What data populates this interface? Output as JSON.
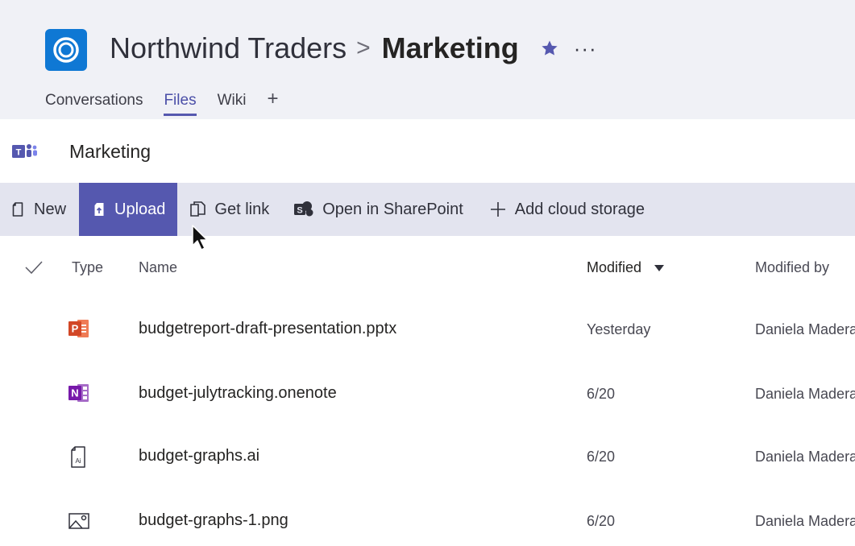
{
  "header": {
    "team_name": "Northwind Traders",
    "separator": ">",
    "channel_name": "Marketing",
    "more_label": "···",
    "tabs": [
      {
        "label": "Conversations",
        "active": false
      },
      {
        "label": "Files",
        "active": true
      },
      {
        "label": "Wiki",
        "active": false
      }
    ],
    "add_tab_label": "+"
  },
  "channel": {
    "title": "Marketing"
  },
  "toolbar": {
    "new_label": "New",
    "upload_label": "Upload",
    "get_link_label": "Get link",
    "open_sharepoint_label": "Open in SharePoint",
    "add_cloud_label": "Add cloud storage"
  },
  "table": {
    "columns": {
      "type": "Type",
      "name": "Name",
      "modified": "Modified",
      "modified_by": "Modified by"
    },
    "rows": [
      {
        "type_icon": "powerpoint-icon",
        "name": "budgetreport-draft-presentation.pptx",
        "modified": "Yesterday",
        "modified_by": "Daniela Madera"
      },
      {
        "type_icon": "onenote-icon",
        "name": "budget-julytracking.onenote",
        "modified": "6/20",
        "modified_by": "Daniela Madera"
      },
      {
        "type_icon": "illustrator-file-icon",
        "name": "budget-graphs.ai",
        "modified": "6/20",
        "modified_by": "Daniela Madera"
      },
      {
        "type_icon": "image-file-icon",
        "name": "budget-graphs-1.png",
        "modified": "6/20",
        "modified_by": "Daniela Madera"
      }
    ]
  },
  "colors": {
    "accent": "#5558af",
    "header_bg": "#f0f1f6",
    "toolbar_bg": "#e3e4ef",
    "powerpoint": "#d24726",
    "onenote": "#7719aa",
    "team_logo": "#0f78d4"
  }
}
